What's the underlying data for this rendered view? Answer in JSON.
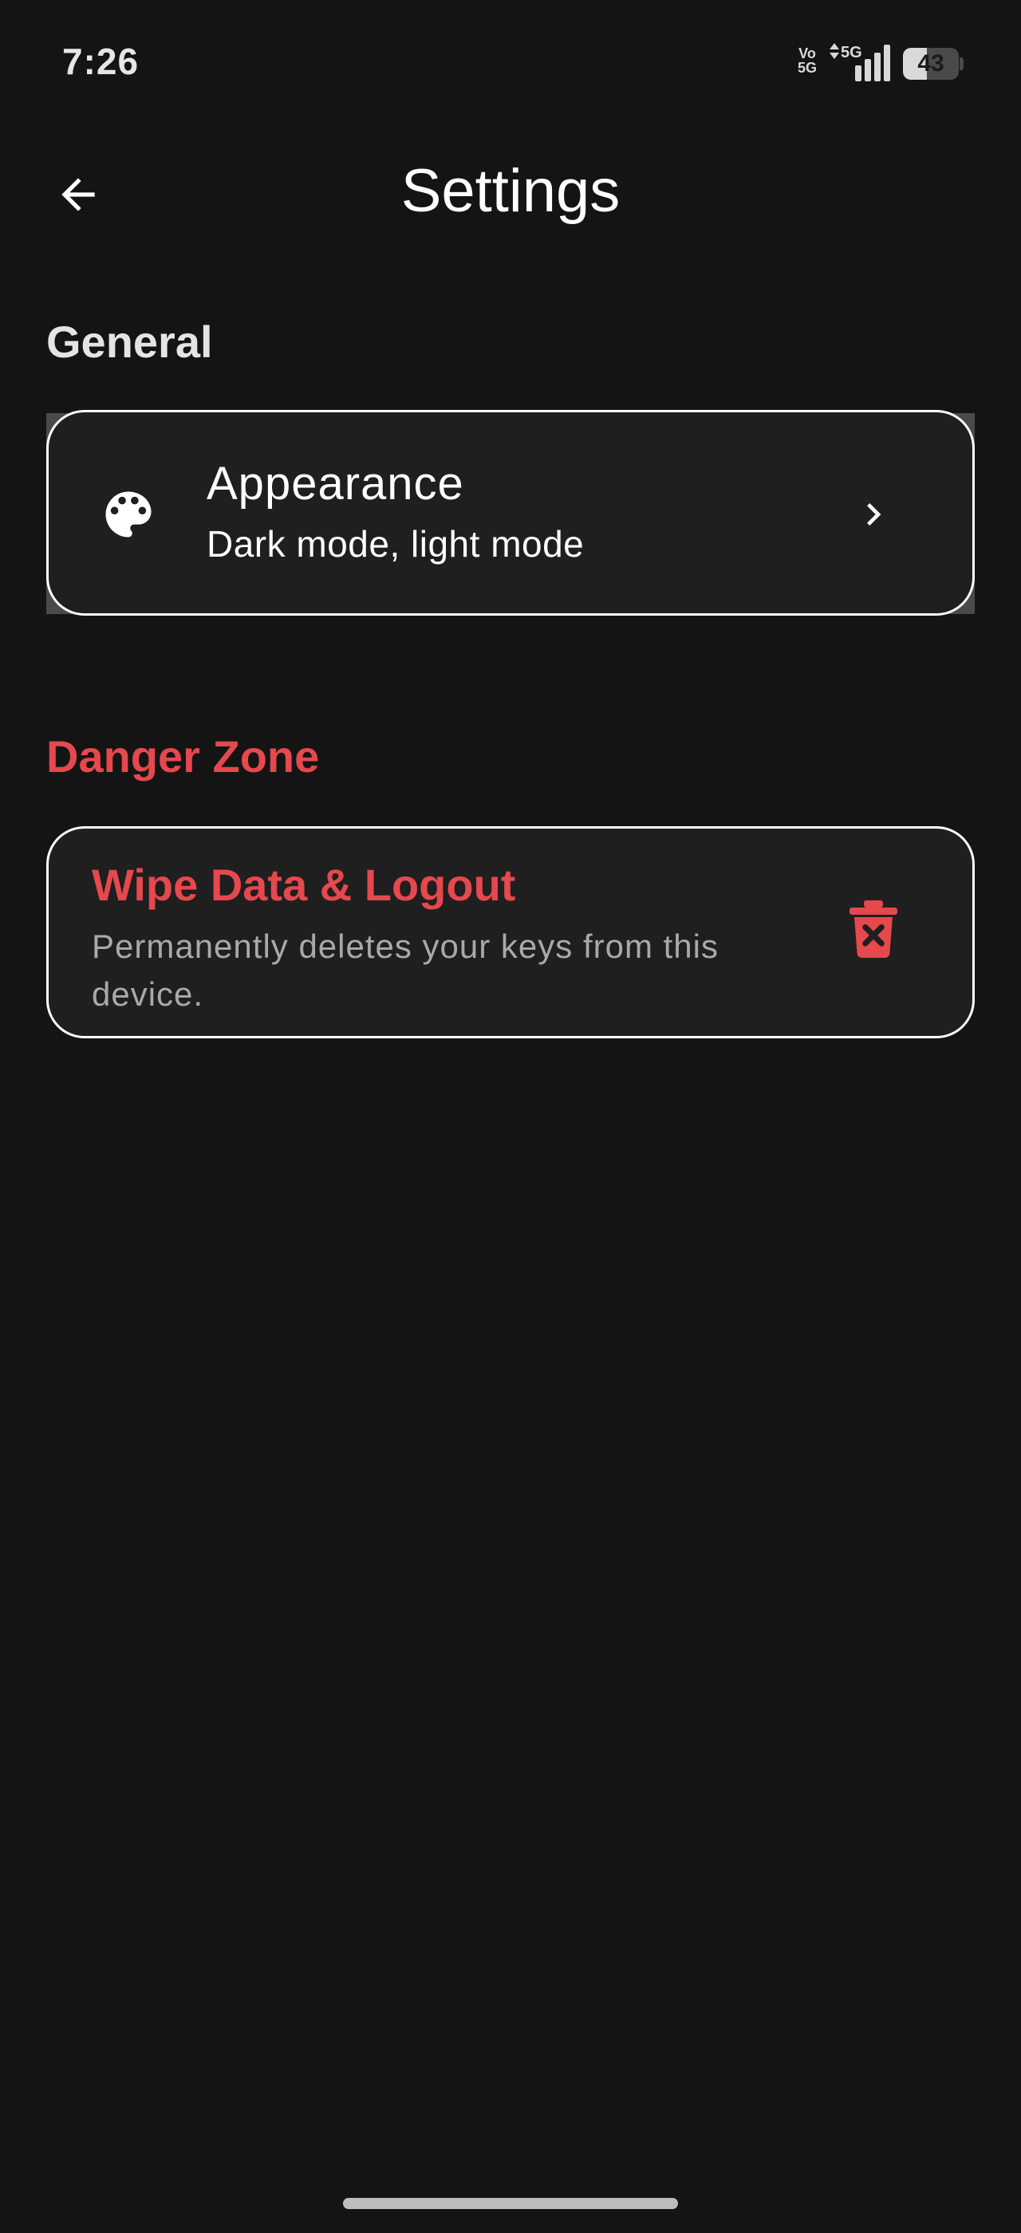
{
  "status_bar": {
    "time": "7:26",
    "volte_line1": "Vo",
    "volte_line2": "5G",
    "network": "5G",
    "battery_level": "43",
    "battery_fraction": 0.43
  },
  "header": {
    "title": "Settings",
    "back_icon": "arrow-left-icon"
  },
  "sections": {
    "general": {
      "title": "General",
      "items": [
        {
          "title": "Appearance",
          "subtitle": "Dark mode, light mode",
          "icon": "palette-icon",
          "trailing_icon": "chevron-right-icon"
        }
      ]
    },
    "danger": {
      "title": "Danger Zone",
      "items": [
        {
          "title": "Wipe Data & Logout",
          "subtitle": "Permanently deletes your keys from this device.",
          "icon": "trash-icon"
        }
      ]
    }
  },
  "colors": {
    "background": "#141414",
    "card": "#1f1f1f",
    "danger": "#e5484d",
    "text_primary": "#ffffff",
    "text_secondary": "#a9a9a9"
  }
}
